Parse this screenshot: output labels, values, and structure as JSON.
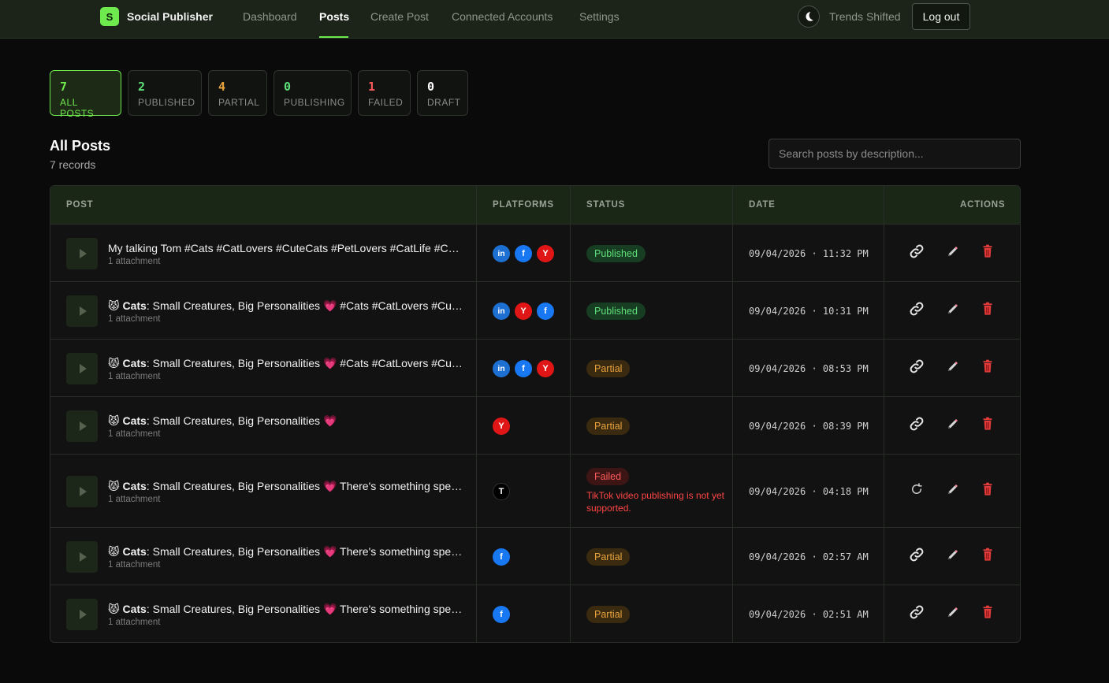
{
  "nav": {
    "brand_letter": "S",
    "brand_name": "Social Publisher",
    "links": [
      "Dashboard",
      "Posts",
      "Create Post",
      "Connected Accounts",
      "Settings"
    ],
    "active": "Posts",
    "user": "Trends Shifted",
    "logout": "Log out"
  },
  "stats": [
    {
      "count": "7",
      "label": "ALL POSTS",
      "color": "#6ee94e"
    },
    {
      "count": "2",
      "label": "PUBLISHED",
      "color": "#5ee07a"
    },
    {
      "count": "4",
      "label": "PARTIAL",
      "color": "#e8a43c"
    },
    {
      "count": "0",
      "label": "PUBLISHING",
      "color": "#5ee07a"
    },
    {
      "count": "1",
      "label": "FAILED",
      "color": "#ff5a5a"
    },
    {
      "count": "0",
      "label": "DRAFT",
      "color": "#ffffff"
    }
  ],
  "section": {
    "title": "All Posts",
    "subtitle": "7 records"
  },
  "search": {
    "placeholder": "Search posts by description..."
  },
  "table": {
    "headers": {
      "post": "POST",
      "platforms": "PLATFORMS",
      "status": "STATUS",
      "date": "DATE",
      "actions": "ACTIONS"
    },
    "rows": [
      {
        "emoji": "",
        "bold": "",
        "title": "My talking Tom #Cats #CatLovers #CuteCats #PetLovers #CatLife #CatsOfInstagram",
        "attachment": "1 attachment",
        "platforms": [
          "linkedin",
          "facebook",
          "youtube"
        ],
        "status": "Published",
        "error": "",
        "date": "09/04/2026 · 11:32 PM",
        "first_action": "link"
      },
      {
        "emoji": "😾",
        "bold": "Cats",
        "title": ": Small Creatures, Big Personalities 💗 #Cats #CatLovers #CuteCats #PetLovers",
        "attachment": "1 attachment",
        "platforms": [
          "linkedin",
          "youtube",
          "facebook"
        ],
        "status": "Published",
        "error": "",
        "date": "09/04/2026 · 10:31 PM",
        "first_action": "link"
      },
      {
        "emoji": "😾",
        "bold": "Cats",
        "title": ": Small Creatures, Big Personalities 💗 #Cats #CatLovers #CuteCats #PetLovers",
        "attachment": "1 attachment",
        "platforms": [
          "linkedin",
          "facebook",
          "youtube"
        ],
        "status": "Partial",
        "error": "",
        "date": "09/04/2026 · 08:53 PM",
        "first_action": "link"
      },
      {
        "emoji": "😾",
        "bold": "Cats",
        "title": ": Small Creatures, Big Personalities 💗",
        "attachment": "1 attachment",
        "platforms": [
          "youtube"
        ],
        "status": "Partial",
        "error": "",
        "date": "09/04/2026 · 08:39 PM",
        "first_action": "link"
      },
      {
        "emoji": "😾",
        "bold": "Cats",
        "title": ": Small Creatures, Big Personalities 💗 There's something special about cats",
        "attachment": "1 attachment",
        "platforms": [
          "tiktok"
        ],
        "status": "Failed",
        "error": "TikTok video publishing is not yet supported.",
        "date": "09/04/2026 · 04:18 PM",
        "first_action": "retry"
      },
      {
        "emoji": "😾",
        "bold": "Cats",
        "title": ": Small Creatures, Big Personalities 💗 There's something special about cats",
        "attachment": "1 attachment",
        "platforms": [
          "facebook"
        ],
        "status": "Partial",
        "error": "",
        "date": "09/04/2026 · 02:57 AM",
        "first_action": "link"
      },
      {
        "emoji": "😾",
        "bold": "Cats",
        "title": ": Small Creatures, Big Personalities 💗 There's something special about cats",
        "attachment": "1 attachment",
        "platforms": [
          "facebook"
        ],
        "status": "Partial",
        "error": "",
        "date": "09/04/2026 · 02:51 AM",
        "first_action": "link"
      }
    ]
  },
  "icons": {
    "linkedin": "in",
    "facebook": "f",
    "youtube": "Y",
    "tiktok": "T"
  }
}
